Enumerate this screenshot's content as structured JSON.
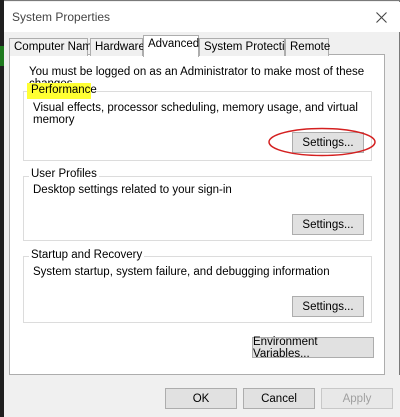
{
  "window": {
    "title": "System Properties"
  },
  "tabs": [
    {
      "label": "Computer Name"
    },
    {
      "label": "Hardware"
    },
    {
      "label": "Advanced"
    },
    {
      "label": "System Protection"
    },
    {
      "label": "Remote"
    }
  ],
  "active_tab": "Advanced",
  "admin_notice": "You must be logged on as an Administrator to make most of these changes.",
  "performance": {
    "label": "Performance",
    "description": "Visual effects, processor scheduling, memory usage, and virtual memory",
    "button": "Settings..."
  },
  "user_profiles": {
    "label": "User Profiles",
    "description": "Desktop settings related to your sign-in",
    "button": "Settings..."
  },
  "startup_recovery": {
    "label": "Startup and Recovery",
    "description": "System startup, system failure, and debugging information",
    "button": "Settings..."
  },
  "environment_button": "Environment Variables...",
  "dialog_buttons": {
    "ok": "OK",
    "cancel": "Cancel",
    "apply": "Apply"
  },
  "colors": {
    "highlight": "#ffff33",
    "annotation_red": "#d42020"
  },
  "icons": [
    "close-icon"
  ]
}
